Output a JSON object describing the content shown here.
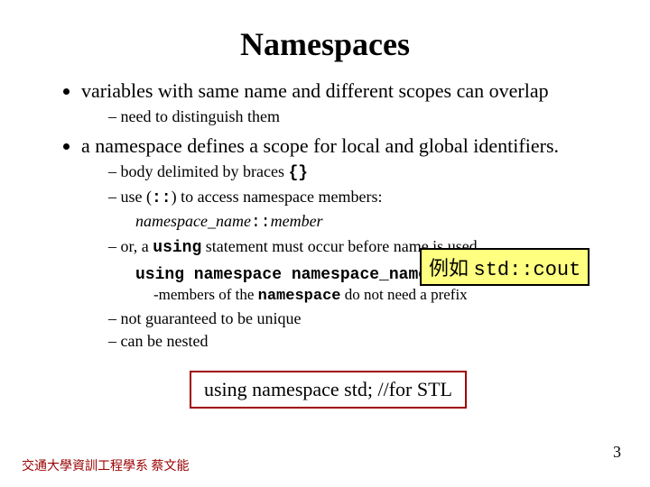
{
  "title": "Namespaces",
  "bullets": {
    "b1": "variables with same name and different scopes can overlap",
    "b1_sub1": "need to distinguish them",
    "b2": "a namespace defines a scope for local and global identifiers.",
    "b2_sub1_a": "body delimited by braces ",
    "b2_sub1_b": "{}",
    "b2_sub2_a": "use (",
    "b2_sub2_b": "::",
    "b2_sub2_c": ") to access namespace members:",
    "b2_sub2_member_a": "namespace_name",
    "b2_sub2_member_b": "::",
    "b2_sub2_member_c": "member",
    "b2_sub3_a": "or, a ",
    "b2_sub3_b": "using",
    "b2_sub3_c": " statement must occur before name is used",
    "using_line": "using namespace namespace_name;",
    "members_note_a": "-members of the ",
    "members_note_b": "namespace",
    "members_note_c": " do not need a prefix",
    "b2_sub4": "not guaranteed to be unique",
    "b2_sub5": "can be nested"
  },
  "callout": {
    "prefix": "例如 ",
    "code": "std::cout"
  },
  "bottom_box": "using namespace std; //for STL",
  "footer": "交通大學資訓工程學系 蔡文能",
  "page": "3"
}
